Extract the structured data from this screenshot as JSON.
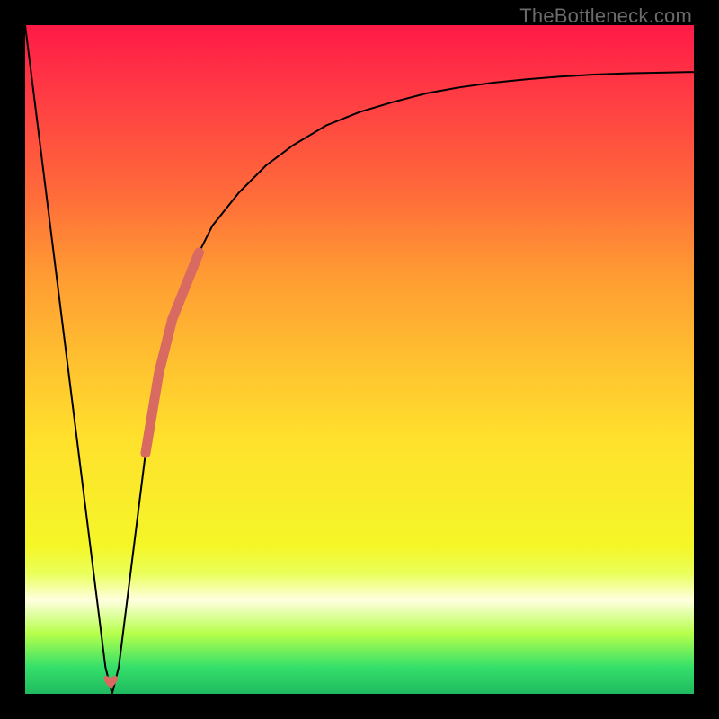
{
  "attribution": "TheBottleneck.com",
  "chart_data": {
    "type": "line",
    "title": "",
    "xlabel": "",
    "ylabel": "",
    "xlim": [
      0,
      100
    ],
    "ylim": [
      0,
      100
    ],
    "grid": false,
    "legend": false,
    "series": [
      {
        "name": "main-curve",
        "color": "#000000",
        "stroke_width": 2,
        "x": [
          0,
          2,
          4,
          6,
          8,
          10,
          11,
          12,
          13,
          14,
          16,
          18,
          20,
          22,
          25,
          28,
          32,
          36,
          40,
          45,
          50,
          55,
          60,
          65,
          70,
          75,
          80,
          85,
          90,
          95,
          100
        ],
        "y": [
          100,
          84,
          68,
          52,
          36,
          20,
          12,
          4,
          0,
          4,
          20,
          36,
          48,
          56,
          64,
          70,
          75,
          79,
          82,
          85,
          87,
          88.5,
          89.8,
          90.7,
          91.4,
          91.9,
          92.3,
          92.6,
          92.8,
          92.9,
          93
        ]
      },
      {
        "name": "highlight-segment",
        "color": "#d86a62",
        "stroke_width": 11,
        "linecap": "round",
        "x": [
          18,
          20,
          22,
          24,
          26
        ],
        "y": [
          36,
          48,
          56,
          61,
          66
        ]
      },
      {
        "name": "minimum-marker",
        "color": "#d86a62",
        "marker": "heart",
        "marker_size": 14,
        "x": [
          12.8
        ],
        "y": [
          1.5
        ]
      }
    ]
  }
}
